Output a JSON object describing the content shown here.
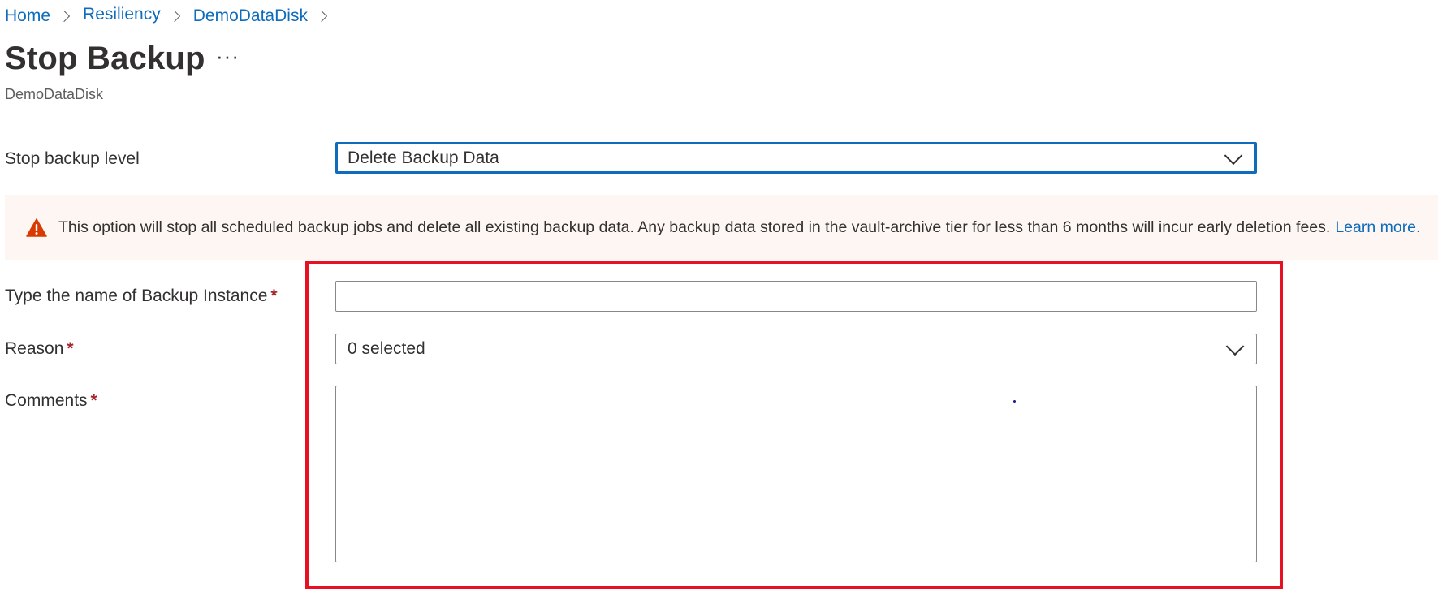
{
  "breadcrumb": {
    "items": [
      {
        "label": "Home"
      },
      {
        "label": "Resiliency"
      },
      {
        "label": "DemoDataDisk"
      }
    ]
  },
  "header": {
    "title": "Stop Backup",
    "more_label": "···",
    "subtitle": "DemoDataDisk"
  },
  "form": {
    "stop_level": {
      "label": "Stop backup level",
      "value": "Delete Backup Data"
    },
    "warning": {
      "text": "This option will stop all scheduled backup jobs and delete all existing backup data. Any backup data stored in the vault-archive tier for less than 6 months will incur early deletion fees.",
      "link": "Learn more."
    },
    "instance_name": {
      "label": "Type the name of Backup Instance",
      "required_mark": "*",
      "value": ""
    },
    "reason": {
      "label": "Reason",
      "required_mark": "*",
      "value": "0 selected"
    },
    "comments": {
      "label": "Comments",
      "required_mark": "*",
      "value": ""
    }
  },
  "colors": {
    "link": "#0f6cbd",
    "required": "#a4262c",
    "warning_bg": "#fdf6f3",
    "warning_icon": "#d83b01",
    "highlight": "#e81123"
  },
  "icons": {
    "warning": "warning-triangle-icon",
    "chevron": "chevron-down-icon",
    "separator": "chevron-right-icon"
  }
}
